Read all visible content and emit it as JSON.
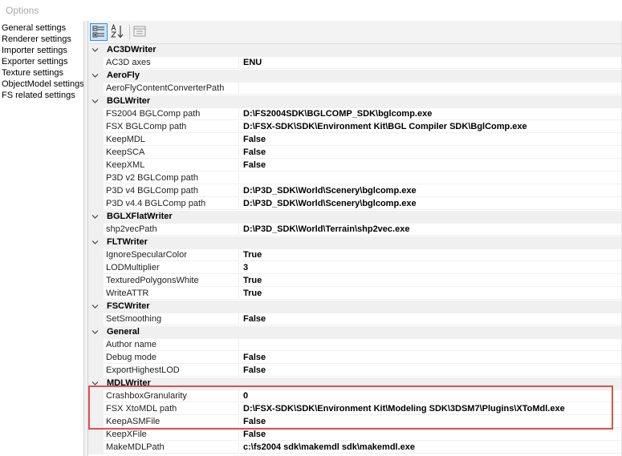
{
  "window": {
    "title": "Options"
  },
  "sidebar": {
    "items": [
      {
        "label": "General settings",
        "name": "sidebar-item-general-settings"
      },
      {
        "label": "Renderer settings",
        "name": "sidebar-item-renderer-settings"
      },
      {
        "label": "Importer settings",
        "name": "sidebar-item-importer-settings"
      },
      {
        "label": "Exporter settings",
        "name": "sidebar-item-exporter-settings"
      },
      {
        "label": "Texture settings",
        "name": "sidebar-item-texture-settings"
      },
      {
        "label": "ObjectModel settings",
        "name": "sidebar-item-objectmodel-settings"
      },
      {
        "label": "FS related settings",
        "name": "sidebar-item-fs-related-settings"
      }
    ]
  },
  "toolbar": {
    "categorized_icon": "categorized-icon",
    "alphabetical_icon": "sort-alphabetical-icon",
    "property_pages_icon": "property-pages-icon",
    "accent": "#3f8fd6"
  },
  "grid": {
    "rows": [
      {
        "type": "cat",
        "label": "AC3DWriter"
      },
      {
        "type": "prop",
        "name": "AC3D axes",
        "value": "ENU"
      },
      {
        "type": "cat",
        "label": "AeroFly"
      },
      {
        "type": "prop",
        "name": "AeroFlyContentConverterPath",
        "value": ""
      },
      {
        "type": "cat",
        "label": "BGLWriter"
      },
      {
        "type": "prop",
        "name": "FS2004 BGLComp path",
        "value": "D:\\FS2004SDK\\BGLCOMP_SDK\\bglcomp.exe"
      },
      {
        "type": "prop",
        "name": "FSX BGLComp path",
        "value": "D:\\FSX-SDK\\SDK\\Environment Kit\\BGL Compiler SDK\\BglComp.exe"
      },
      {
        "type": "prop",
        "name": "KeepMDL",
        "value": "False"
      },
      {
        "type": "prop",
        "name": "KeepSCA",
        "value": "False"
      },
      {
        "type": "prop",
        "name": "KeepXML",
        "value": "False"
      },
      {
        "type": "prop",
        "name": "P3D v2 BGLComp path",
        "value": ""
      },
      {
        "type": "prop",
        "name": "P3D v4 BGLComp path",
        "value": "D:\\P3D_SDK\\World\\Scenery\\bglcomp.exe"
      },
      {
        "type": "prop",
        "name": "P3D v4.4 BGLComp path",
        "value": "D:\\P3D_SDK\\World\\Scenery\\bglcomp.exe"
      },
      {
        "type": "cat",
        "label": "BGLXFlatWriter"
      },
      {
        "type": "prop",
        "name": "shp2vecPath",
        "value": "D:\\P3D_SDK\\World\\Terrain\\shp2vec.exe"
      },
      {
        "type": "cat",
        "label": "FLTWriter"
      },
      {
        "type": "prop",
        "name": "IgnoreSpecularColor",
        "value": "True"
      },
      {
        "type": "prop",
        "name": "LODMultiplier",
        "value": "3"
      },
      {
        "type": "prop",
        "name": "TexturedPolygonsWhite",
        "value": "True"
      },
      {
        "type": "prop",
        "name": "WriteATTR",
        "value": "True"
      },
      {
        "type": "cat",
        "label": "FSCWriter"
      },
      {
        "type": "prop",
        "name": "SetSmoothing",
        "value": "False"
      },
      {
        "type": "cat",
        "label": "General"
      },
      {
        "type": "prop",
        "name": "Author name",
        "value": ""
      },
      {
        "type": "prop",
        "name": "Debug mode",
        "value": "False"
      },
      {
        "type": "prop",
        "name": "ExportHighestLOD",
        "value": "False"
      },
      {
        "type": "cat",
        "label": "MDLWriter"
      },
      {
        "type": "prop",
        "name": "CrashboxGranularity",
        "value": "0"
      },
      {
        "type": "prop",
        "name": "FSX XtoMDL path",
        "value": "D:\\FSX-SDK\\SDK\\Environment Kit\\Modeling SDK\\3DSM7\\Plugins\\XToMdl.exe"
      },
      {
        "type": "prop",
        "name": "KeepASMFile",
        "value": "False"
      },
      {
        "type": "prop",
        "name": "KeepXFile",
        "value": "False"
      },
      {
        "type": "prop",
        "name": "MakeMDLPath",
        "value": "c:\\fs2004 sdk\\makemdl sdk\\makemdl.exe"
      }
    ]
  },
  "highlight": {
    "color": "#d9534f"
  }
}
